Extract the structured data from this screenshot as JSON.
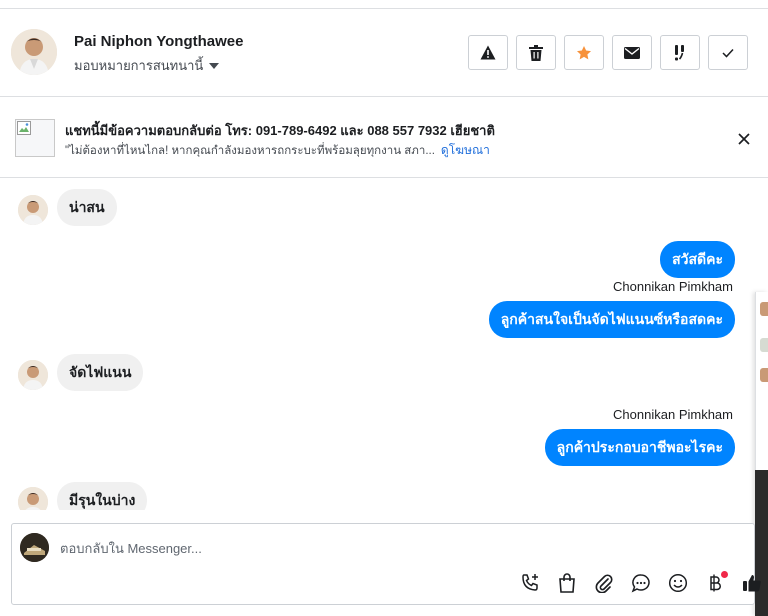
{
  "header": {
    "contact_name": "Pai Niphon Yongthawee",
    "assign_label": "มอบหมายการสนทนานี้",
    "actions": [
      {
        "name": "spam",
        "icon": "warning-icon"
      },
      {
        "name": "delete",
        "icon": "trash-icon"
      },
      {
        "name": "star",
        "icon": "star-icon",
        "color": "#f7923b"
      },
      {
        "name": "mark-unread",
        "icon": "envelope-icon"
      },
      {
        "name": "follow-up",
        "icon": "exclamation-icon"
      },
      {
        "name": "mark-done",
        "icon": "check-icon"
      }
    ]
  },
  "ad_banner": {
    "title": "แชทนี้มีข้อความตอบกลับต่อ โทร: 091-789-6492 และ 088 557 7932 เฮียชาติ",
    "description": "\"ไม่ต้องหาที่ไหนไกล! หากคุณกำลังมองหารถกระบะที่พร้อมลุยทุกงาน สภา...",
    "link_text": "ดูโฆษณา"
  },
  "messages": [
    {
      "direction": "in",
      "text": "น่าสน"
    },
    {
      "direction": "out",
      "text": "สวัสดีคะ"
    },
    {
      "direction": "out",
      "sender": "Chonnikan Pimkham",
      "text": "ลูกค้าสนใจเป็นจัดไฟแนนซ์หรือสดคะ"
    },
    {
      "direction": "in",
      "text": "จัดไฟแนน"
    },
    {
      "direction": "out",
      "sender": "Chonnikan Pimkham",
      "text": "ลูกค้าประกอบอาชีพอะไรคะ"
    },
    {
      "direction": "in",
      "text": "มีรุนในบ่าง"
    }
  ],
  "composer": {
    "placeholder": "ตอบกลับใน Messenger...",
    "tools": [
      "phone-add-icon",
      "shopping-bag-icon",
      "paperclip-icon",
      "saved-reply-icon",
      "emoji-icon",
      "baht-icon",
      "thumbs-up-icon"
    ]
  },
  "colors": {
    "outgoing_bubble": "#0084ff",
    "incoming_bubble": "#f0f0f0",
    "link": "#216fdb",
    "notification_dot": "#f02849"
  }
}
